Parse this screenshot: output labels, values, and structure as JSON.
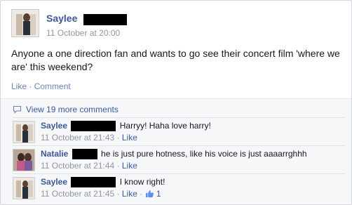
{
  "post": {
    "author": "Saylee",
    "time": "11 October at 20:00",
    "text": "Anyone a one direction fan and wants to go see their concert film 'where we are' this weekend?",
    "like_label": "Like",
    "separator": " · ",
    "comment_label": "Comment"
  },
  "comments_section": {
    "view_more": "View 19 more comments",
    "comments": [
      {
        "author": "Saylee",
        "text": "Harryy! Haha love harry!",
        "time": "11 October at 21:43",
        "sep": " · ",
        "like": "Like",
        "like_count": ""
      },
      {
        "author": "Natalie",
        "text": "he is just pure hotness, like his voice is just aaaarrghhh",
        "time": "11 October at 21:44",
        "sep": " · ",
        "like": "Like",
        "like_count": ""
      },
      {
        "author": "Saylee",
        "text": "I know right!",
        "time": "11 October at 21:45",
        "sep": " · ",
        "like": "Like",
        "like_count": "1"
      }
    ]
  },
  "colors": {
    "link_blue": "#3b5998",
    "muted_gray": "#9197a3",
    "redaction": "#000000"
  }
}
